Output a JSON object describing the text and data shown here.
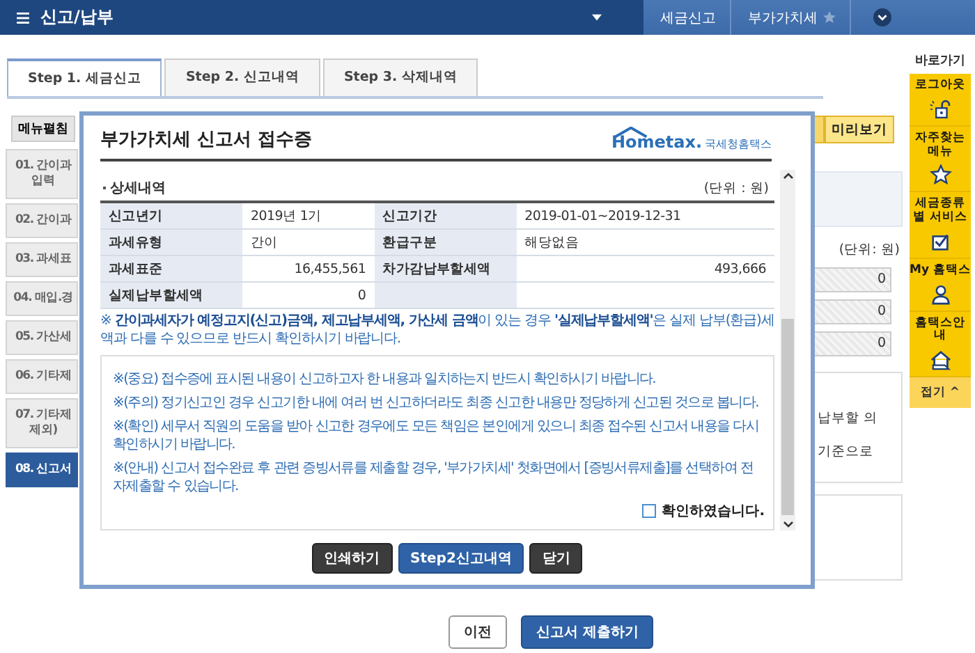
{
  "header": {
    "menu_title": "신고/납부",
    "breadcrumb": [
      "세금신고",
      "부가가치세"
    ]
  },
  "tabs": [
    {
      "label": "Step 1. 세금신고",
      "selected": true
    },
    {
      "label": "Step 2. 신고내역",
      "selected": false
    },
    {
      "label": "Step 3. 삭제내역",
      "selected": false
    }
  ],
  "menu_toggle": "메뉴펼침",
  "side_menu": [
    {
      "lines": [
        "01. 간이과",
        "입력"
      ],
      "selected": false
    },
    {
      "lines": [
        "02. 간이과"
      ],
      "selected": false
    },
    {
      "lines": [
        "03. 과세표"
      ],
      "selected": false
    },
    {
      "lines": [
        "04. 매입.경"
      ],
      "selected": false
    },
    {
      "lines": [
        "05. 가산세"
      ],
      "selected": false
    },
    {
      "lines": [
        "06. 기타제"
      ],
      "selected": false
    },
    {
      "lines": [
        "07. 기타제",
        "제외)"
      ],
      "selected": false
    },
    {
      "lines": [
        "08. 신고서"
      ],
      "selected": true
    }
  ],
  "background": {
    "preview_button": "미리보기",
    "unit": "(단위: 원)",
    "fields": [
      "0",
      "0",
      "0"
    ],
    "notes": [
      "납부할 의",
      "기준으로"
    ]
  },
  "quick_bar": {
    "title": "바로가기",
    "items": [
      {
        "label": "로그아웃",
        "kind": "lock"
      },
      {
        "label": "자주찾는 메뉴",
        "kind": "star"
      },
      {
        "label": "세금종류별 서비스",
        "kind": "check"
      },
      {
        "label": "My 홈택스",
        "kind": "person"
      },
      {
        "label": "홈택스안내",
        "kind": "house"
      }
    ],
    "collapse": "접기 ^"
  },
  "modal": {
    "title": "부가가치세 신고서 접수증",
    "logo_text": "Hometax.",
    "logo_caption": "국세청홈택스",
    "section_title": "상세내역",
    "unit": "(단위 : 원)",
    "rows": [
      [
        {
          "text": "신고년기",
          "kind": "head"
        },
        {
          "text": "2019년 1기",
          "kind": "text"
        },
        {
          "text": "신고기간",
          "kind": "head"
        },
        {
          "text": "2019-01-01~2019-12-31",
          "kind": "text"
        }
      ],
      [
        {
          "text": "과세유형",
          "kind": "head"
        },
        {
          "text": "간이",
          "kind": "text"
        },
        {
          "text": "환급구분",
          "kind": "head"
        },
        {
          "text": "해당없음",
          "kind": "text"
        }
      ],
      [
        {
          "text": "과세표준",
          "kind": "head"
        },
        {
          "text": "16,455,561",
          "kind": "num"
        },
        {
          "text": "차가감납부할세액",
          "kind": "head"
        },
        {
          "text": "493,666",
          "kind": "num"
        }
      ],
      [
        {
          "text": "실제납부할세액",
          "kind": "head"
        },
        {
          "text": "0",
          "kind": "num"
        }
      ]
    ],
    "note": "※ **간이과세자가 예정고지(신고)금액, 제고납부세액, 가산세 금액**이 있는 경우 **'실제납부할세액'**은 실제 납부(환급)세액과 다를 수 있으므로 반드시 확인하시기 바랍니다.",
    "notices": [
      "※(중요) 접수증에 표시된 내용이 신고하고자 한 내용과 일치하는지 반드시 확인하시기 바랍니다.",
      "※(주의) 정기신고인 경우 신고기한 내에 여러 번 신고하더라도 최종 신고한 내용만 정당하게 신고된 것으로 봅니다.",
      "※(확인) 세무서 직원의 도움을 받아 신고한 경우에도 모든 책임은 본인에게 있으니 최종 접수된 신고서 내용을 다시 확인하시기 바랍니다.",
      "※(안내) 신고서 접수완료 후 관련 증빙서류를 제출할 경우, '부가가치세' 첫화면에서 [증빙서류제출]를 선택하여 전자제출할 수 있습니다."
    ],
    "confirm": {
      "label": "확인하였습니다.",
      "checked": false
    },
    "buttons": [
      {
        "label": "인쇄하기",
        "kind": "dark"
      },
      {
        "label": "Step2신고내역",
        "kind": "primary"
      },
      {
        "label": "닫기",
        "kind": "dark"
      }
    ]
  },
  "footer_buttons": [
    {
      "label": "이전",
      "kind": "plain"
    },
    {
      "label": "신고서 제출하기",
      "kind": "primary"
    }
  ]
}
